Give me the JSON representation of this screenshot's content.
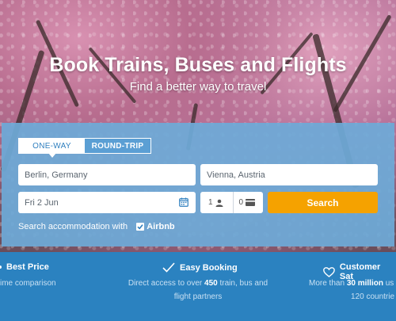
{
  "hero": {
    "title": "Book Trains, Buses and Flights",
    "subtitle": "Find a better way to travel"
  },
  "search_form": {
    "tabs": [
      {
        "label": "ONE-WAY",
        "active": true
      },
      {
        "label": "ROUND-TRIP",
        "active": false
      }
    ],
    "origin_value": "Berlin, Germany",
    "destination_value": "Vienna, Austria",
    "date_value": "Fri 2 Jun",
    "passengers": {
      "count": "1",
      "icon": "person-icon"
    },
    "discount_cards": {
      "count": "0",
      "icon": "card-icon"
    },
    "search_label": "Search",
    "accommodation_label": "Search accommodation with",
    "accommodation_brand": "Airbnb",
    "accommodation_checked": true
  },
  "features": [
    {
      "title": "Best Price",
      "icon": "",
      "line1": "ime comparison",
      "line2": ""
    },
    {
      "title": "Easy Booking",
      "icon": "checkmark-icon",
      "line1_pre": "Direct access to over ",
      "line1_bold": "450",
      "line1_post": " train, bus and",
      "line2": "flight partners"
    },
    {
      "title": "Customer Sat",
      "icon": "heart-icon",
      "line1_pre": "More than ",
      "line1_bold": "30 million",
      "line1_post": " us",
      "line2": "120 countrie"
    }
  ],
  "colors": {
    "accent_orange": "#f5a200",
    "panel_blue": "#6eaad7",
    "bottom_blue": "#2b82c0",
    "tab_text_blue": "#2f7fbf"
  }
}
